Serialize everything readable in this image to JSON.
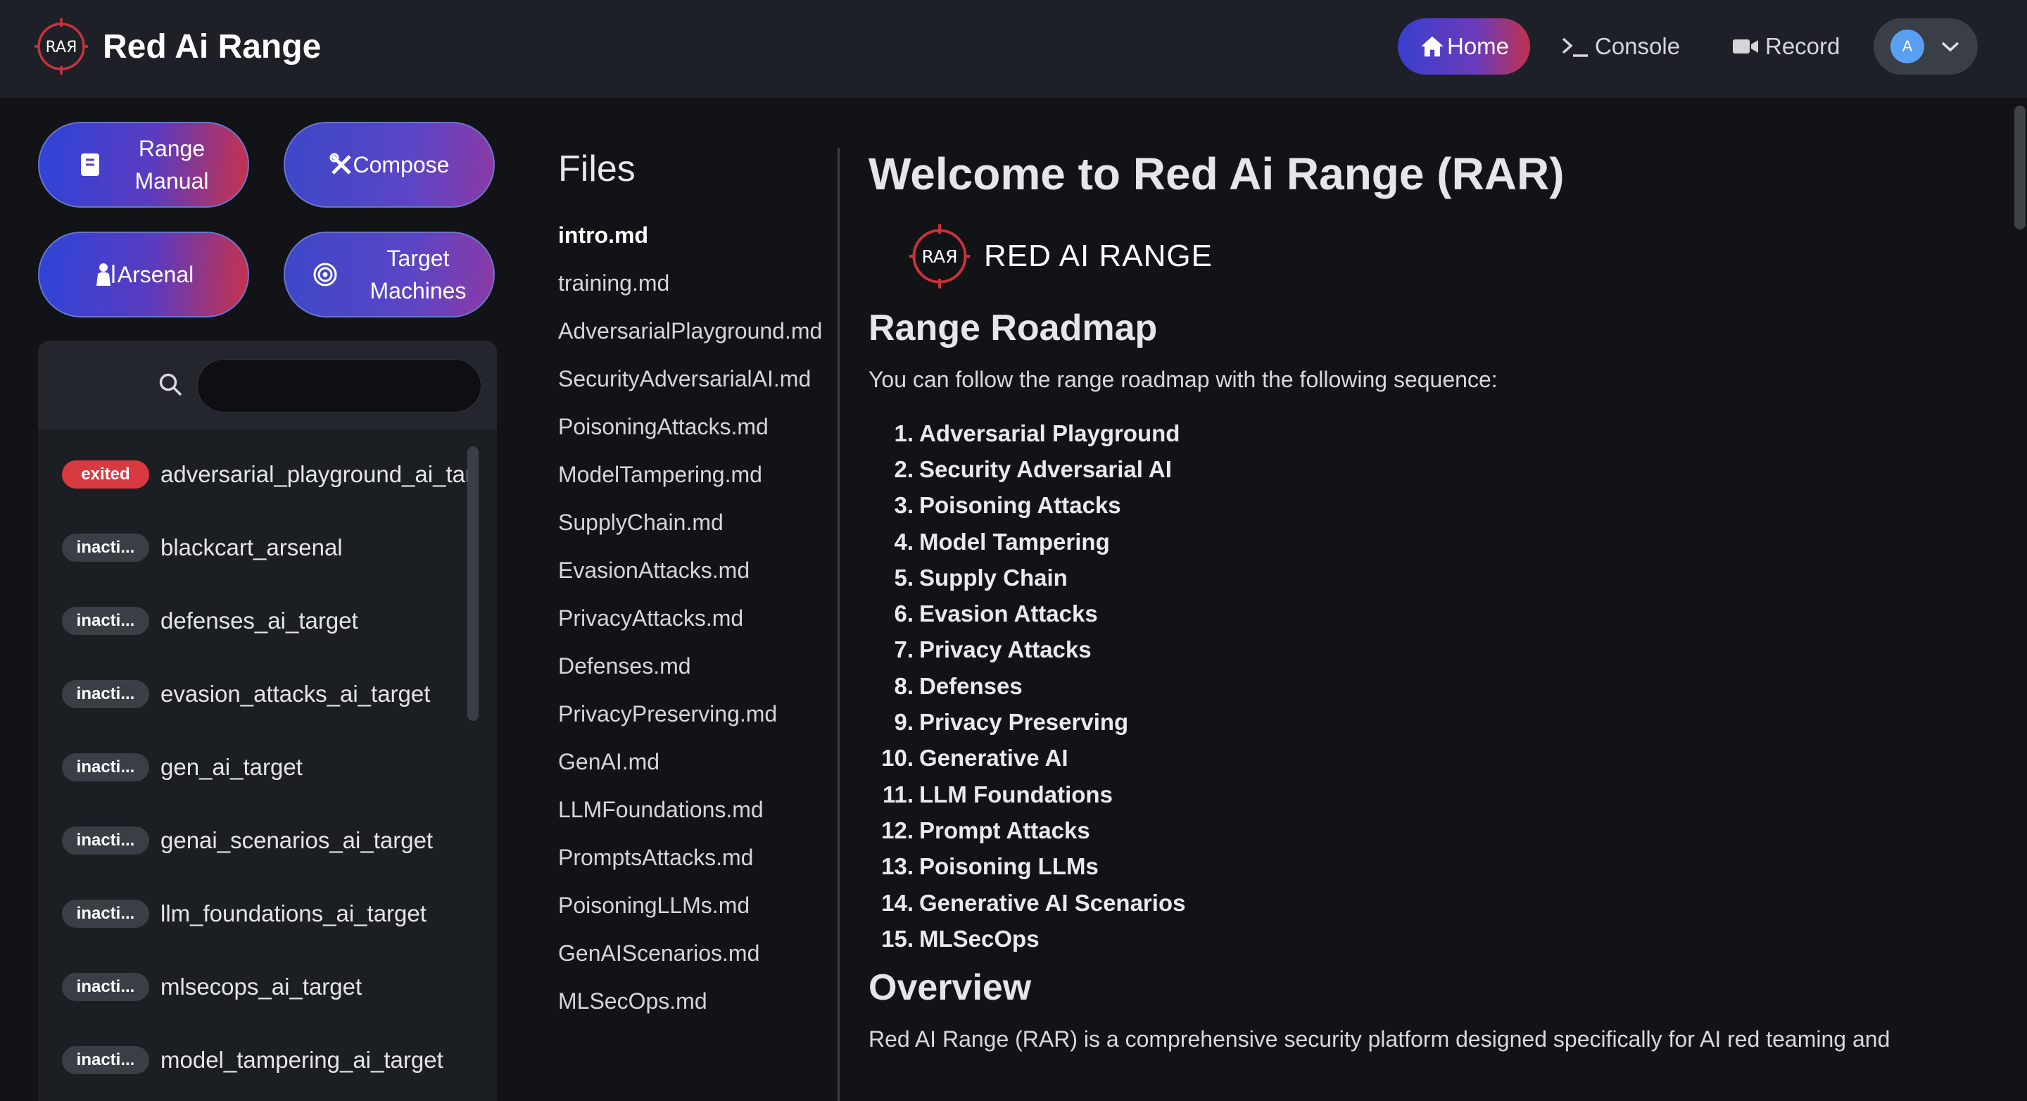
{
  "header": {
    "brand_name": "Red Ai Range",
    "logo_text": "RAЯ",
    "nav": {
      "home": "Home",
      "console": "Console",
      "record": "Record"
    },
    "user_initial": "A"
  },
  "sidebar": {
    "buttons": {
      "range_manual_l1": "Range",
      "range_manual_l2": "Manual",
      "compose": "Compose",
      "arsenal": "Arsenal",
      "target_l1": "Target",
      "target_l2": "Machines"
    },
    "search": {
      "value": "",
      "placeholder": ""
    },
    "items": [
      {
        "status": "exited",
        "name": "adversarial_playground_ai_target"
      },
      {
        "status": "inacti...",
        "name": "blackcart_arsenal"
      },
      {
        "status": "inacti...",
        "name": "defenses_ai_target"
      },
      {
        "status": "inacti...",
        "name": "evasion_attacks_ai_target"
      },
      {
        "status": "inacti...",
        "name": "gen_ai_target"
      },
      {
        "status": "inacti...",
        "name": "genai_scenarios_ai_target"
      },
      {
        "status": "inacti...",
        "name": "llm_foundations_ai_target"
      },
      {
        "status": "inacti...",
        "name": "mlsecops_ai_target"
      },
      {
        "status": "inacti...",
        "name": "model_tampering_ai_target"
      }
    ]
  },
  "files": {
    "title": "Files",
    "list": [
      "intro.md",
      "training.md",
      "AdversarialPlayground.md",
      "SecurityAdversarialAI.md",
      "PoisoningAttacks.md",
      "ModelTampering.md",
      "SupplyChain.md",
      "EvasionAttacks.md",
      "PrivacyAttacks.md",
      "Defenses.md",
      "PrivacyPreserving.md",
      "GenAI.md",
      "LLMFoundations.md",
      "PromptsAttacks.md",
      "PoisoningLLMs.md",
      "GenAIScenarios.md",
      "MLSecOps.md"
    ]
  },
  "content": {
    "title": "Welcome to Red Ai Range (RAR)",
    "banner_text": "RED AI RANGE",
    "roadmap_heading": "Range Roadmap",
    "roadmap_intro": "You can follow the range roadmap with the following sequence:",
    "roadmap": [
      "Adversarial Playground",
      "Security Adversarial AI",
      "Poisoning Attacks",
      "Model Tampering",
      "Supply Chain",
      "Evasion Attacks",
      "Privacy Attacks",
      "Defenses",
      "Privacy Preserving",
      "Generative AI",
      "LLM Foundations",
      "Prompt Attacks",
      "Poisoning LLMs",
      "Generative AI Scenarios",
      "MLSecOps"
    ],
    "overview_heading": "Overview",
    "overview_text": "Red AI Range (RAR) is a comprehensive security platform designed specifically for AI red teaming and"
  },
  "colors": {
    "background": "#111316",
    "topbar": "#1d2127",
    "accent_blue": "#3a3fd0",
    "accent_red": "#c0324e",
    "exited_badge": "#d93a42",
    "avatar": "#5aa0f2"
  }
}
